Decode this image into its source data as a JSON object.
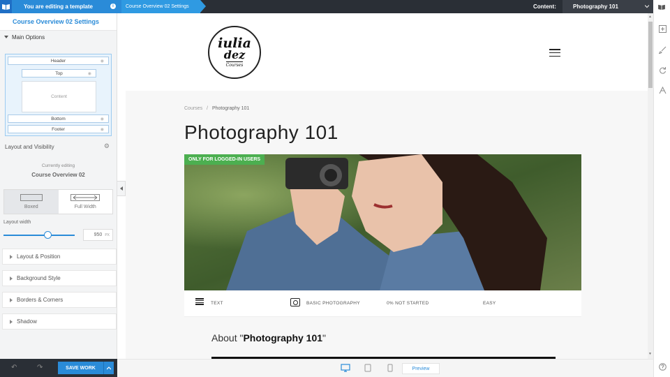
{
  "topbar": {
    "editing_label": "You are editing a template",
    "breadcrumb": "Course Overview 02 Settings",
    "content_label": "Content:",
    "content_value": "Photography 101"
  },
  "panel": {
    "title": "Course Overview 02 Settings",
    "main_options": "Main Options",
    "layout": {
      "header": "Header",
      "top": "Top",
      "content": "Content",
      "bottom": "Bottom",
      "footer": "Footer"
    },
    "layout_visibility": "Layout and Visibility",
    "currently_editing_label": "Currently editing",
    "currently_editing_name": "Course Overview 02",
    "width_options": [
      "Boxed",
      "Full Width"
    ],
    "width_selected": "Boxed",
    "layout_width_label": "Layout width",
    "layout_width_value": "950",
    "layout_width_unit": "PX",
    "layout_width_slider": 0.62,
    "accordions": [
      "Layout & Position",
      "Background Style",
      "Borders & Corners",
      "Shadow"
    ]
  },
  "bottom": {
    "save_label": "SAVE WORK",
    "preview_label": "Preview"
  },
  "site": {
    "logo": {
      "line1": "iulia",
      "line2": "dez",
      "line3": "Courses"
    },
    "breadcrumb_root": "Courses",
    "breadcrumb_sep": "/",
    "breadcrumb_current": "Photography 101",
    "course_title": "Photography 101",
    "badge": "ONLY FOR LOGGED-IN USERS",
    "info": {
      "type": "TEXT",
      "topic": "BASIC PHOTOGRAPHY",
      "progress": "0% NOT STARTED",
      "difficulty": "EASY"
    },
    "about_prefix": "About \"",
    "about_name": "Photography 101",
    "about_suffix": "\""
  },
  "colors": {
    "accent": "#2a8bd8",
    "topbar": "#2a2f36",
    "badge": "#4caf50"
  },
  "icons": {
    "topbar_logo": "book-icon",
    "info": "info-icon",
    "gear": "gear-icon",
    "undo": "undo-icon",
    "redo": "redo-icon",
    "desktop": "desktop-icon",
    "tablet": "tablet-icon",
    "mobile": "mobile-icon",
    "right_toolbar": [
      "book-icon",
      "add-icon",
      "brush-icon",
      "refresh-icon",
      "style-icon",
      "help-icon"
    ]
  }
}
